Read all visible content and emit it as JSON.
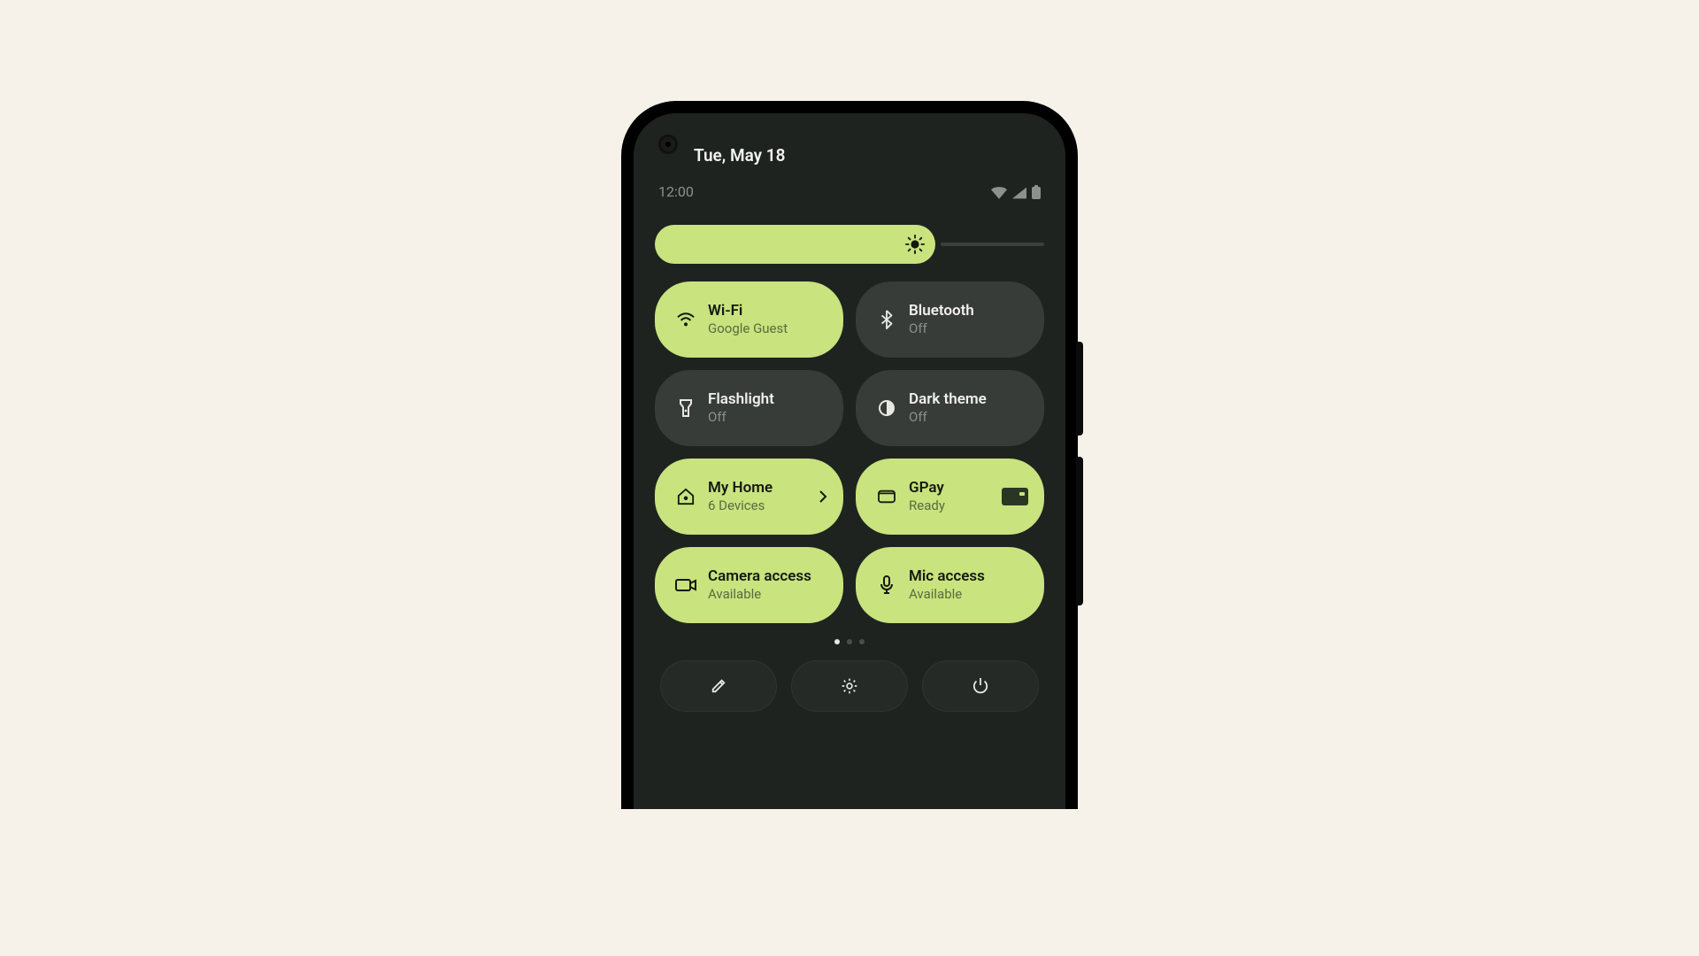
{
  "colors": {
    "accent": "#c9e37e",
    "bg_dark": "#1f2320",
    "tile_off": "#383c38",
    "stage_bg": "#f6f2ea"
  },
  "header": {
    "date": "Tue, May 18",
    "time": "12:00"
  },
  "brightness": {
    "percent": 72
  },
  "tiles": [
    {
      "key": "wifi",
      "label": "Wi-Fi",
      "sub": "Google Guest",
      "active": true,
      "icon": "wifi-icon",
      "trailing": null
    },
    {
      "key": "bluetooth",
      "label": "Bluetooth",
      "sub": "Off",
      "active": false,
      "icon": "bluetooth-icon",
      "trailing": null
    },
    {
      "key": "flashlight",
      "label": "Flashlight",
      "sub": "Off",
      "active": false,
      "icon": "flashlight-icon",
      "trailing": null
    },
    {
      "key": "darktheme",
      "label": "Dark theme",
      "sub": "Off",
      "active": false,
      "icon": "dark-theme-icon",
      "trailing": null
    },
    {
      "key": "home",
      "label": "My Home",
      "sub": "6 Devices",
      "active": true,
      "icon": "home-icon",
      "trailing": "chevron"
    },
    {
      "key": "gpay",
      "label": "GPay",
      "sub": "Ready",
      "active": true,
      "icon": "wallet-icon",
      "trailing": "card"
    },
    {
      "key": "camera",
      "label": "Camera access",
      "sub": "Available",
      "active": true,
      "icon": "camera-icon",
      "trailing": null
    },
    {
      "key": "mic",
      "label": "Mic access",
      "sub": "Available",
      "active": true,
      "icon": "mic-icon",
      "trailing": null
    }
  ],
  "pager": {
    "count": 3,
    "active": 0
  },
  "footer": {
    "buttons": [
      "edit",
      "settings",
      "power"
    ]
  }
}
